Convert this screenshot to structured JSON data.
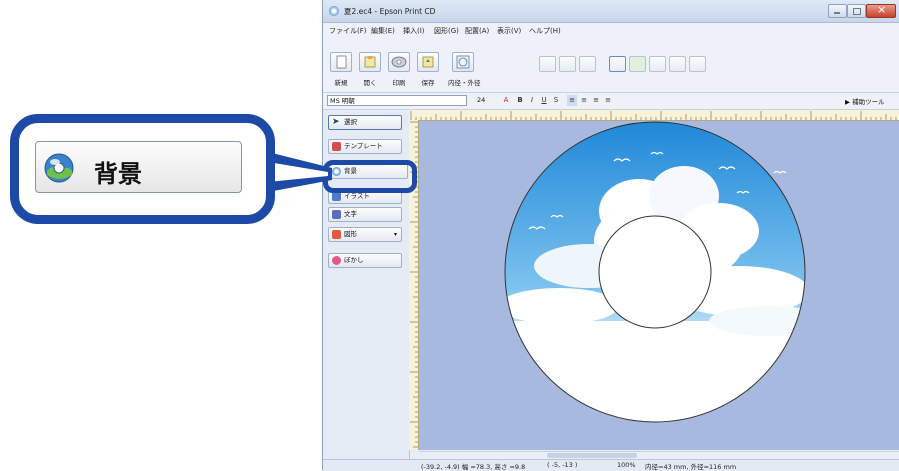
{
  "window": {
    "title": "夏2.ec4 - Epson Print CD",
    "menu": [
      "ファイル(F)",
      "編集(E)",
      "挿入(I)",
      "図形(G)",
      "配置(A)",
      "表示(V)",
      "ヘルプ(H)"
    ]
  },
  "toolbar": {
    "buttons": [
      "新規",
      "開く",
      "印刷",
      "保存",
      "内径・外径"
    ]
  },
  "format_bar": {
    "font": "MS 明朝",
    "size": "24",
    "assist_tool": "補助ツール"
  },
  "side_panel": {
    "items": [
      "選択",
      "テンプレート",
      "背景",
      "イラスト",
      "文字",
      "図形",
      "ぼかし"
    ]
  },
  "status_bar": {
    "position": "(-39.2, -4.9) 幅 =78.3, 高さ =9.8",
    "cursor": "( -5, -13 )",
    "zoom": "100%",
    "diameters": "内径=43 mm, 外径=116 mm"
  },
  "callout": {
    "label": "背景"
  },
  "colors": {
    "highlight": "#1c4aa6",
    "canvas": "#a8b9df",
    "sky_top": "#3b9be0"
  },
  "icons": [
    "app-icon",
    "new-file-icon",
    "open-folder-icon",
    "print-icon",
    "save-icon",
    "disc-size-icon",
    "background-disc-icon",
    "select-arrow-icon"
  ]
}
